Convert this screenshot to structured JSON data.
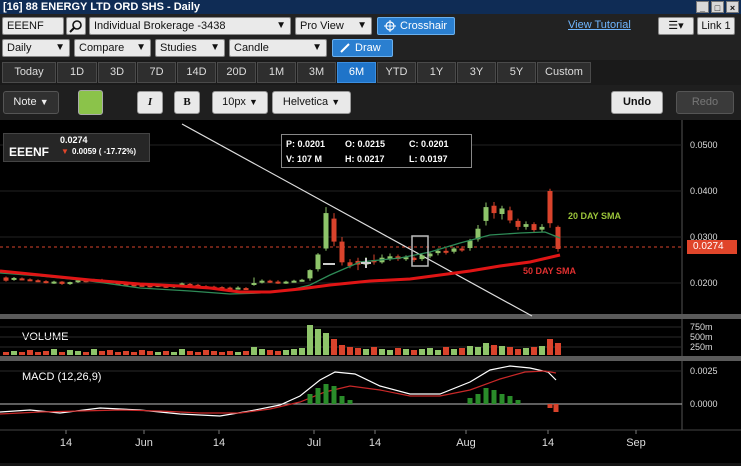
{
  "window": {
    "title": "[16] 88 ENERGY LTD ORD SHS - Daily",
    "controls": [
      "_",
      "□",
      "×"
    ]
  },
  "toolbar1": {
    "symbol": "EEENF",
    "account": "Individual Brokerage -3438",
    "view": "Pro View",
    "crosshair": "Crosshair",
    "tutorial": "View Tutorial",
    "link": "Link 1"
  },
  "toolbar2": {
    "frequency": "Daily",
    "compare": "Compare",
    "studies": "Studies",
    "chart_style": "Candle",
    "draw": "Draw"
  },
  "ranges": [
    "Today",
    "1D",
    "3D",
    "7D",
    "14D",
    "20D",
    "1M",
    "3M",
    "6M",
    "YTD",
    "1Y",
    "3Y",
    "5Y",
    "Custom"
  ],
  "active_range": "6M",
  "annotation_toolbar": {
    "note": "Note",
    "color": "#8bc34a",
    "italic": "I",
    "bold": "B",
    "size": "10px",
    "font": "Helvetica",
    "undo": "Undo",
    "redo": "Redo"
  },
  "quote": {
    "symbol": "EEENF",
    "price": "0.0274",
    "change": "0.0059 ( -17.72%)",
    "change_color": "#e0452a"
  },
  "ohlc": {
    "p": "P: 0.0201",
    "o": "O: 0.0215",
    "c": "C: 0.0201",
    "v": "V: 107 M",
    "h": "H: 0.0217",
    "l": "L: 0.0197"
  },
  "price_axis": [
    "0.0500",
    "0.0400",
    "0.0300",
    "0.0200"
  ],
  "price_tag": "0.0274",
  "sma_labels": {
    "sma20": "20 DAY SMA",
    "sma50": "50 DAY SMA"
  },
  "volume": {
    "label": "VOLUME",
    "axis": [
      "750m",
      "500m",
      "250m"
    ]
  },
  "macd": {
    "label": "MACD (12,26,9)",
    "axis": [
      "0.0025",
      "0.0000"
    ]
  },
  "x_axis": [
    "14",
    "Jun",
    "14",
    "Jul",
    "14",
    "Aug",
    "14",
    "Sep"
  ],
  "colors": {
    "up": "#8ec46a",
    "down": "#d9432c",
    "sma20": "#2e8b57",
    "sma50": "#e01515",
    "accent": "#1f74c9"
  }
}
